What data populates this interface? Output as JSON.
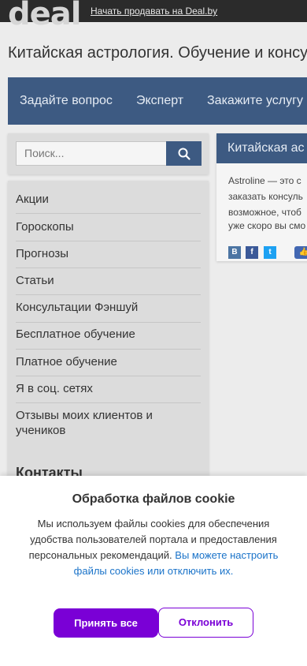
{
  "header": {
    "logo": "deal",
    "sell_link": "Начать продавать на Deal.by"
  },
  "site": {
    "title": "Китайская астрология. Обучение и консу"
  },
  "nav": {
    "items": [
      "Задайте вопрос",
      "Эксперт",
      "Закажите услугу"
    ]
  },
  "search": {
    "placeholder": "Поиск...",
    "icon": "search-icon"
  },
  "menu": {
    "items": [
      "Акции",
      "Гороскопы",
      "Прогнозы",
      "Статьи",
      "Консультации Фэншуй",
      "Бесплатное обучение",
      "Платное обучение",
      "Я в соц. сетях",
      "Отзывы моих клиентов и учеников"
    ],
    "contacts_title": "Контакты"
  },
  "panel": {
    "heading": "Китайская ас",
    "lines": [
      "Astroline — это с",
      "заказать консуль",
      "возможное, чтоб",
      "уже скоро вы смо"
    ],
    "share_icons": [
      "vk-icon",
      "facebook-icon",
      "twitter-icon",
      "like-icon"
    ]
  },
  "cookie": {
    "title": "Обработка файлов cookie",
    "text": "Мы используем файлы cookies для обеспечения удобства пользователей портала и предоставления персональных рекомендаций.",
    "link": "Вы можете настроить файлы cookies или отключить их.",
    "accept": "Принять все",
    "decline": "Отклонить"
  },
  "colors": {
    "nav_bg": "#3d5a82",
    "accent": "#7a00d6",
    "link": "#1a73c9"
  }
}
